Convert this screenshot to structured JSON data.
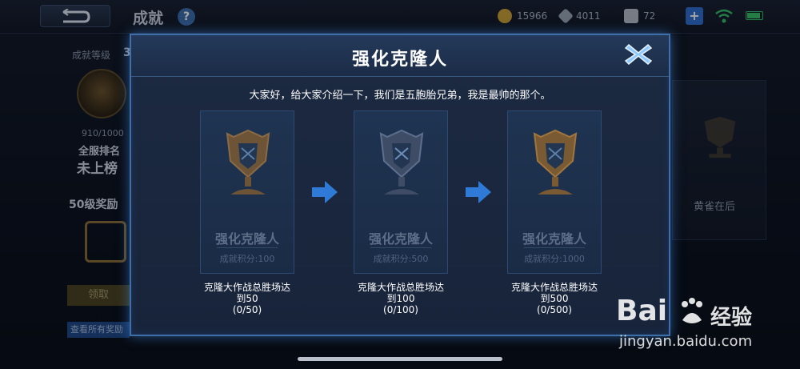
{
  "header": {
    "title": "成就",
    "help": "?",
    "resources": [
      {
        "value": "15966",
        "color": "#c9a23a",
        "icon": "gold-coin-icon"
      },
      {
        "value": "4011",
        "color": "#9aa6b8",
        "icon": "diamond-icon"
      },
      {
        "value": "72",
        "color": "#b7bfcb",
        "icon": "coupon-icon"
      }
    ],
    "add": "+"
  },
  "left_panel": {
    "level_label": "成就等级",
    "level_value": "3",
    "progress": "910/1000",
    "rank_label": "全服排名",
    "rank_value": "未上榜",
    "reward_label": "50级奖励",
    "claim_button": "领取",
    "view_all_button": "查看所有奖励"
  },
  "right_card": {
    "label": "黄雀在后"
  },
  "modal": {
    "title": "强化克隆人",
    "intro": "大家好，给大家介绍一下，我们是五胞胎兄弟，我是最帅的那个。",
    "stages": [
      {
        "name": "强化克隆人",
        "points": "成就积分:100",
        "condition_line1": "克隆大作战总胜场达",
        "condition_line2": "到50",
        "progress": "(0/50)",
        "tier": "bronze"
      },
      {
        "name": "强化克隆人",
        "points": "成就积分:500",
        "condition_line1": "克隆大作战总胜场达",
        "condition_line2": "到100",
        "progress": "(0/100)",
        "tier": "silver"
      },
      {
        "name": "强化克隆人",
        "points": "成就积分:1000",
        "condition_line1": "克隆大作战总胜场达",
        "condition_line2": "到500",
        "progress": "(0/500)",
        "tier": "gold"
      }
    ]
  },
  "watermark": {
    "brand": "Bai",
    "brand_cn": "经验",
    "url": "jingyan.baidu.com"
  },
  "colors": {
    "accent": "#3e6fa8",
    "arrow": "#2f7ad6",
    "bronze": "#8a6a45",
    "silver": "#5d6f8e",
    "gold": "#a0763e"
  }
}
